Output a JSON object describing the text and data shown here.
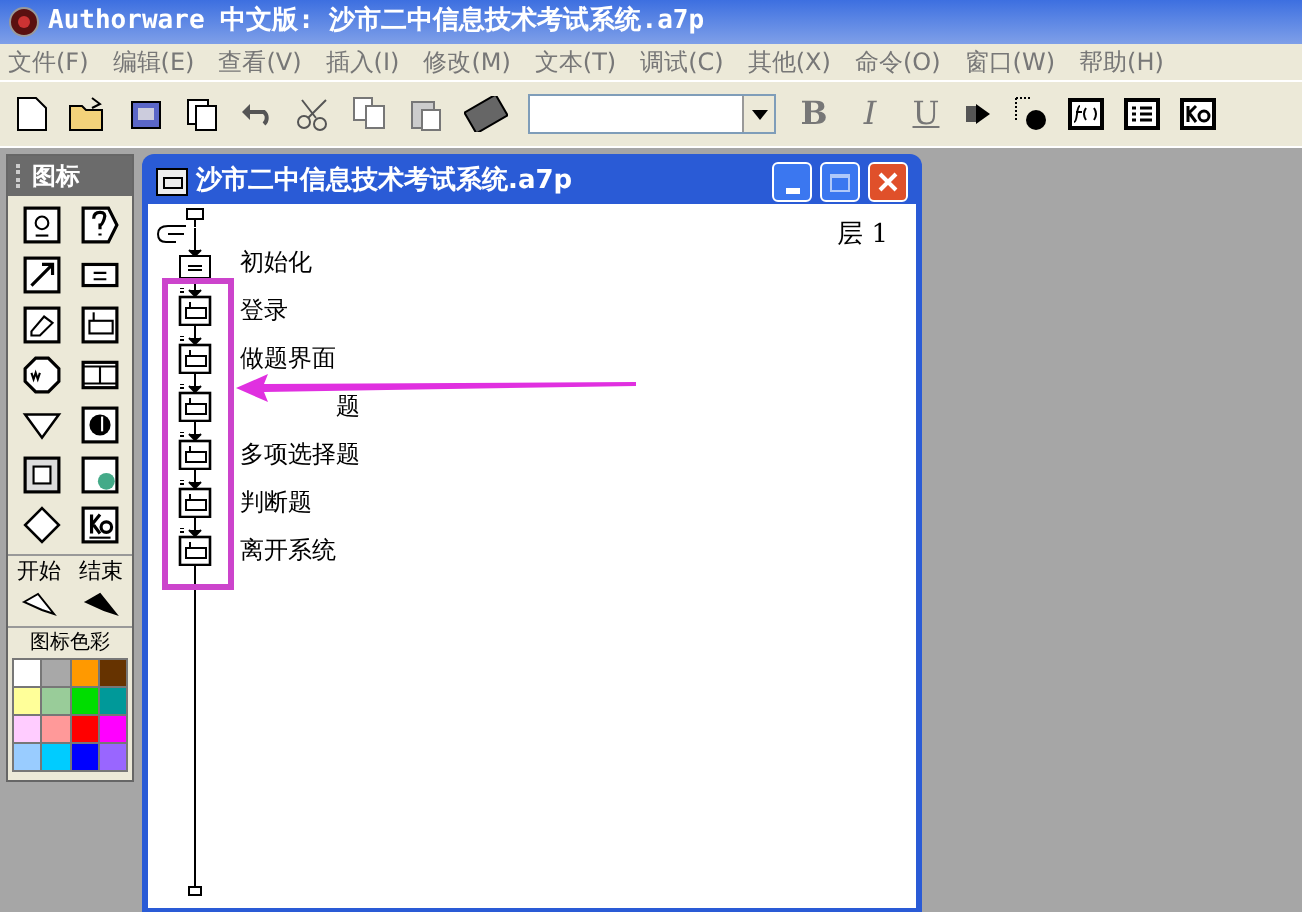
{
  "app_title": "Authorware 中文版: 沙市二中信息技术考试系统.a7p",
  "menu": [
    {
      "label": "文件(F)"
    },
    {
      "label": "编辑(E)"
    },
    {
      "label": "查看(V)"
    },
    {
      "label": "插入(I)"
    },
    {
      "label": "修改(M)"
    },
    {
      "label": "文本(T)"
    },
    {
      "label": "调试(C)"
    },
    {
      "label": "其他(X)"
    },
    {
      "label": "命令(O)"
    },
    {
      "label": "窗口(W)"
    },
    {
      "label": "帮助(H)"
    }
  ],
  "text_style_buttons": [
    "B",
    "I",
    "U"
  ],
  "palette": {
    "title": "图标",
    "start_label": "开始",
    "end_label": "结束",
    "colors_title": "图标色彩",
    "colors": [
      {
        "color": "#ffffff"
      },
      {
        "color": "#a8a8a8"
      },
      {
        "color": "#ff9900"
      },
      {
        "color": "#663300"
      },
      {
        "color": "#ffff99"
      },
      {
        "color": "#99cc99"
      },
      {
        "color": "#00dd00"
      },
      {
        "color": "#009999"
      },
      {
        "color": "#ffccff"
      },
      {
        "color": "#ff9999"
      },
      {
        "color": "#ff0000"
      },
      {
        "color": "#ff00ff"
      },
      {
        "color": "#99ccff"
      },
      {
        "color": "#00ccff"
      },
      {
        "color": "#0000ff"
      },
      {
        "color": "#9966ff"
      }
    ]
  },
  "flow_window": {
    "title": "沙市二中信息技术考试系统.a7p",
    "level": "层 1",
    "items": [
      {
        "kind": "calculation",
        "label": "初始化"
      },
      {
        "kind": "map",
        "label": "登录"
      },
      {
        "kind": "map",
        "label": "做题界面"
      },
      {
        "kind": "map",
        "label": "题",
        "covered": true
      },
      {
        "kind": "map",
        "label": "多项选择题"
      },
      {
        "kind": "map",
        "label": "判断题"
      },
      {
        "kind": "map",
        "label": "离开系统"
      }
    ]
  }
}
